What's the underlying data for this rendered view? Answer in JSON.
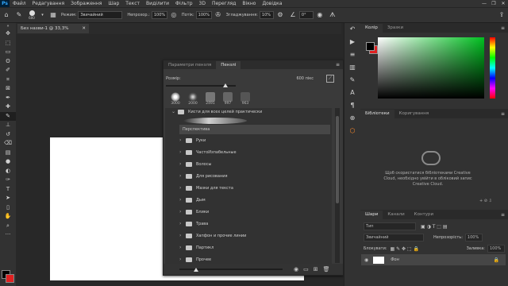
{
  "menubar": {
    "logo": "Ps",
    "items": [
      "Файл",
      "Редагування",
      "Зображення",
      "Шар",
      "Текст",
      "Виділити",
      "Фільтр",
      "3D",
      "Перегляд",
      "Вікно",
      "Довідка"
    ],
    "window_controls": [
      "—",
      "❐",
      "✕"
    ]
  },
  "options": {
    "brush_size": "600",
    "mode_label": "Режим:",
    "mode_value": "Звичайний",
    "opacity_label": "Непрозор.:",
    "opacity_value": "100%",
    "pressure_label": "Потік:",
    "flow_value": "100%",
    "smoothing_label": "Згладжування:",
    "smoothing_value": "10%",
    "angle_value": "0°"
  },
  "document": {
    "tab_title": "Без назви-1 @ 33,3% (RGB/8#)",
    "close": "✕"
  },
  "colors": {
    "foreground": "#000000",
    "background": "#e02020",
    "picker_hue": "#00c020"
  },
  "brush_panel": {
    "tabs": [
      "Параметри пензля",
      "Пензлі"
    ],
    "active_tab": "Пензлі",
    "size_label": "Розмір:",
    "size_value": "600 пікс",
    "presets": [
      {
        "num": "3000"
      },
      {
        "num": "2000"
      },
      {
        "num": "2491"
      },
      {
        "num": "997"
      },
      {
        "num": "963"
      }
    ],
    "group_top": "Кисти для всех целей практически",
    "perspective": "Перспектива",
    "folders": [
      "Руки",
      "ЧастоИзпабельные",
      "Волосы",
      "Для рисования",
      "Мазки для текста",
      "Дым",
      "Блики",
      "Трава",
      "Хапфон и прочие линии",
      "Партикл",
      "Прочее"
    ]
  },
  "right_panels": {
    "color_tabs": [
      "Колір",
      "Зразки"
    ],
    "lib_tabs": [
      "Бібліотеки",
      "Коригування"
    ],
    "lib_message": "Щоб скористатися бібліотеками Creative Cloud, необхідно увійти в обліковий запис Creative Cloud.",
    "layer_tabs": [
      "Шари",
      "Канали",
      "Контури"
    ],
    "layer_kind_placeholder": "Тип",
    "blend_mode": "Звичайний",
    "opacity_label": "Непрозорість:",
    "opacity_value": "100%",
    "lock_label": "Блокувати:",
    "fill_label": "Заливка:",
    "fill_value": "100%",
    "layer_name": "Фон"
  }
}
